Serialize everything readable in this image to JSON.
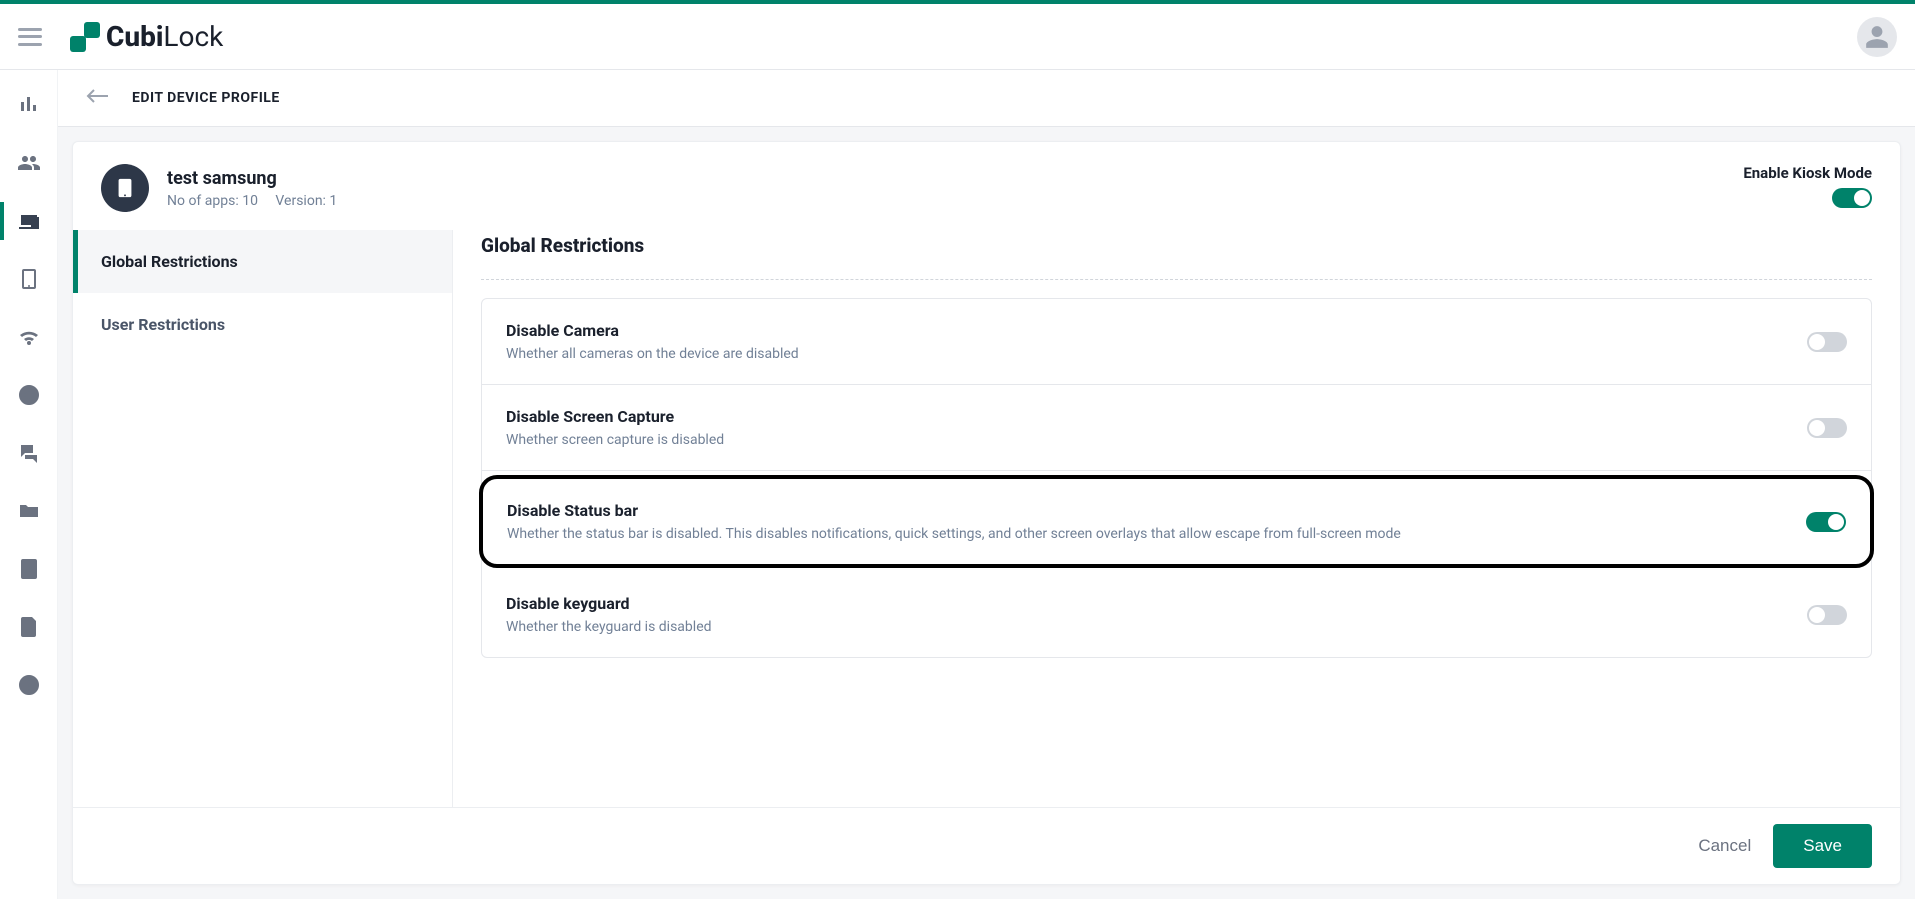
{
  "brand": {
    "name_bold": "Cubi",
    "name_thin": "Lock"
  },
  "breadcrumb": {
    "title": "EDIT DEVICE PROFILE"
  },
  "profile": {
    "name": "test samsung",
    "apps_label": "No of apps: 10",
    "version_label": "Version: 1"
  },
  "kiosk": {
    "label": "Enable Kiosk Mode",
    "enabled": true
  },
  "tabs": [
    {
      "label": "Global Restrictions",
      "active": true
    },
    {
      "label": "User Restrictions",
      "active": false
    }
  ],
  "section": {
    "title": "Global Restrictions"
  },
  "settings": [
    {
      "title": "Disable Camera",
      "desc": "Whether all cameras on the device are disabled",
      "enabled": false,
      "highlight": false
    },
    {
      "title": "Disable Screen Capture",
      "desc": "Whether screen capture is disabled",
      "enabled": false,
      "highlight": false
    },
    {
      "title": "Disable Status bar",
      "desc": "Whether the status bar is disabled. This disables notifications, quick settings, and other screen overlays that allow escape from full-screen mode",
      "enabled": true,
      "highlight": true
    },
    {
      "title": "Disable keyguard",
      "desc": "Whether the keyguard is disabled",
      "enabled": false,
      "highlight": false
    }
  ],
  "footer": {
    "cancel": "Cancel",
    "save": "Save"
  }
}
